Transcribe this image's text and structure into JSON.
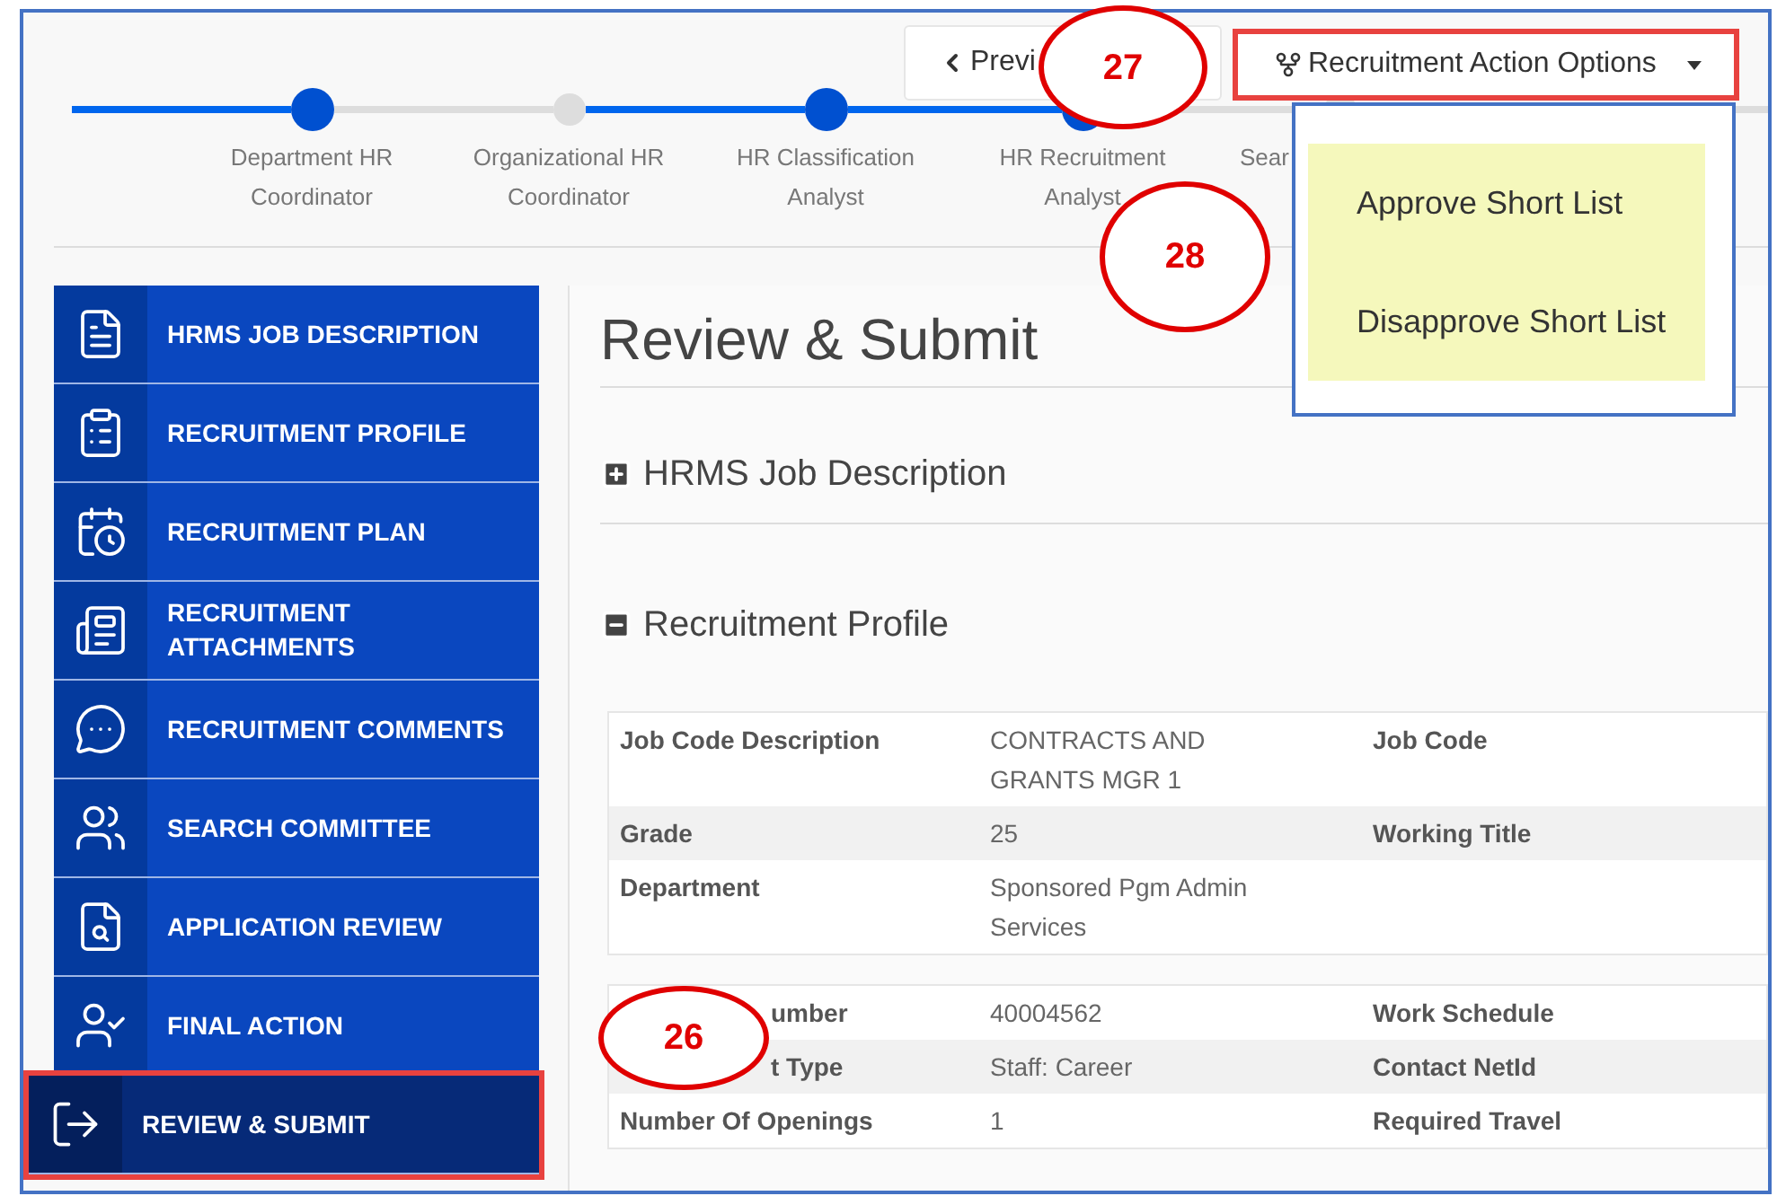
{
  "stepper": {
    "steps": [
      {
        "label": "Department HR Coordinator",
        "active": true
      },
      {
        "label": "Organizational HR Coordinator",
        "active": false
      },
      {
        "label": "HR Classification Analyst",
        "active": true
      },
      {
        "label": "HR Recruitment Analyst",
        "active": true
      },
      {
        "label": "Sear",
        "active": false
      }
    ]
  },
  "toolbar": {
    "previous": {
      "label": "Previ",
      "callout": "27"
    },
    "action_button": {
      "label": "Recruitment Action Options",
      "highlighted": true
    }
  },
  "dropdown": {
    "callout": "28",
    "items": [
      {
        "label": "Approve Short List"
      },
      {
        "label": "Disapprove Short List"
      }
    ]
  },
  "sidebar": {
    "items": [
      {
        "label": "HRMS JOB DESCRIPTION",
        "selected": false
      },
      {
        "label": "RECRUITMENT PROFILE",
        "selected": false
      },
      {
        "label": "RECRUITMENT PLAN",
        "selected": false
      },
      {
        "label": "RECRUITMENT ATTACHMENTS",
        "selected": false
      },
      {
        "label": "RECRUITMENT COMMENTS",
        "selected": false
      },
      {
        "label": "SEARCH COMMITTEE",
        "selected": false
      },
      {
        "label": "APPLICATION REVIEW",
        "selected": false
      },
      {
        "label": "FINAL ACTION",
        "selected": false
      },
      {
        "label": "REVIEW & SUBMIT",
        "selected": true
      }
    ]
  },
  "main": {
    "title": "Review & Submit",
    "sections": [
      {
        "title": "HRMS Job Description",
        "expanded": false
      },
      {
        "title": "Recruitment Profile",
        "expanded": true
      }
    ],
    "tables": [
      {
        "rows": [
          {
            "label": "Job Code Description",
            "value": "CONTRACTS AND GRANTS MGR 1",
            "label_2": "Job Code"
          },
          {
            "label": "Grade",
            "value": "25",
            "label_2": "Working Title"
          },
          {
            "label": "Department",
            "value": "Sponsored Pgm Admin Services"
          }
        ]
      },
      {
        "callout": "26",
        "rows": [
          {
            "label": "umber",
            "value": "40004562",
            "label_2": "Work Schedule"
          },
          {
            "label": "t Type",
            "value": "Staff: Career",
            "label_2": "Contact NetId"
          },
          {
            "label": "Number Of Openings",
            "value": "1",
            "label_2": "Required Travel"
          }
        ]
      }
    ]
  }
}
